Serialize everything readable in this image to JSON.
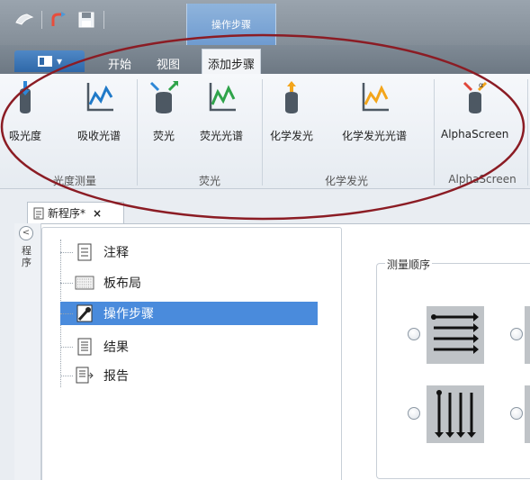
{
  "title_bar": {
    "context_tab_label": "操作步骤"
  },
  "ribbon": {
    "tabs": [
      {
        "label": "开始",
        "active": false
      },
      {
        "label": "视图",
        "active": false
      },
      {
        "label": "添加步骤",
        "active": true
      }
    ],
    "groups": [
      {
        "label": "光度测量",
        "buttons": [
          {
            "label": "吸光度",
            "icon": "absorbance-icon"
          },
          {
            "label": "吸收光谱",
            "icon": "absorbance-spectrum-icon"
          }
        ]
      },
      {
        "label": "荧光",
        "buttons": [
          {
            "label": "荧光",
            "icon": "fluorescence-icon"
          },
          {
            "label": "荧光光谱",
            "icon": "fluorescence-spectrum-icon"
          }
        ]
      },
      {
        "label": "化学发光",
        "buttons": [
          {
            "label": "化学发光",
            "icon": "luminescence-icon"
          },
          {
            "label": "化学发光光谱",
            "icon": "luminescence-spectrum-icon"
          }
        ]
      },
      {
        "label": "AlphaScreen",
        "buttons": [
          {
            "label": "AlphaScreen",
            "icon": "alphascreen-icon"
          }
        ]
      }
    ]
  },
  "document": {
    "tab_label": "新程序*",
    "side_label": "程序",
    "tree": [
      {
        "label": "注释",
        "icon": "notes-icon",
        "selected": false
      },
      {
        "label": "板布局",
        "icon": "plate-layout-icon",
        "selected": false
      },
      {
        "label": "操作步骤",
        "icon": "wrench-icon",
        "selected": true
      },
      {
        "label": "结果",
        "icon": "results-icon",
        "selected": false
      },
      {
        "label": "报告",
        "icon": "report-icon",
        "selected": false
      }
    ],
    "measure_order": {
      "title": "测量顺序",
      "options": [
        {
          "icon": "row-order-icon"
        },
        {
          "icon": "column-order-icon"
        }
      ]
    }
  },
  "colors": {
    "selection": "#4a8bdc",
    "active_tab": "#f3f5f8",
    "annotation": "#8b1c24"
  }
}
